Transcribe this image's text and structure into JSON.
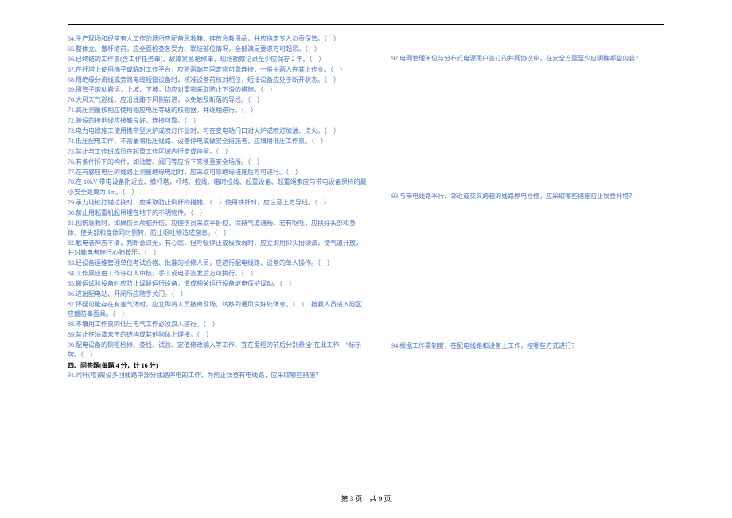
{
  "lines_left": [
    "64.生产现场和经常有人工作的场所应配备急救箱，存放急救用品，并应指定专人负责保管。（　）",
    "65.整体立、撤杆塔前，应全面检查各受力、联结部位情况，全部满足要求方可起吊。（　）",
    "66.已终结的工作票(含工作任务单)、故障紧急抢修单，现场勘察记录至少应保存 2 年。（　）",
    "67.在杆塔上使用梯子或临时工作平台，应将两端与固定物可靠连接，一般由两人在其上作业。（　）",
    "68.用绝缘分流线或旁路电缆短接设备时，核准设备前核对相位，短接设备应处于断开状态。（　）",
    "69.用管子滚动搬运，上坡、下坡，均应对重物采取防止下滑的措施。（　）",
    "70.大风天气巡线，应沿线路下风侧前进，以免触及断落的导线。（　）",
    "71.高压测量核相应使用相应电压等级的核相器，并逐相进行。（　）",
    "72.装设的接地线应接触良好，连接可靠。（　）",
    "73.电力电缆施工使用携带型火炉或喷灯作业时，可在变电站门口对火炉或喷灯加油、点火。（　）",
    "74.低压配电工作，不需要将低压线路、设备停电或做安全措施者，应填用低压工作票。（　）",
    "75.禁止与工作班成员在起重工作区域内行走或停留。（　）",
    "76.有条件拆下的构件，如油管、阀门等应拆下来移至安全场所。（　）",
    "77.在有感应电压的线路上测量绝缘电阻时，应采取可靠绝缘措施后方可进行。（　）",
    "78.在 10kV 带电设备附近立、撤杆塔，杆塔、拉线、临时拉线、起重设备、起重绳索应与带电设备保持的最小安全距离为 1m。（　）",
    "79.承力地桩打锚拉挽时，应采取防止倒杆的措施，（　）使用铁钎时，应注意上方导线。（　）",
    "80.禁止用起重机起吊埋在地下的不明物件。（　）",
    "81.创伤急救时，如果伤员颅脑外伤，应使伤员采取平卧位，保持气道通畅，若有呕吐，应扶好头部和身体，使头部和身体同时侧转，防止呕吐物造成窒息。（　）",
    "82.触电者神志不清，判断意识无，有心跳，但呼吸停止或极微弱时，应立即用仰头抬颌法，使气道开放，并对触电者施行心肺按压。（　）",
    "83.经设备运维管理单位考试合格、批准的检修人员，应进行配电线路、设备的单人操作。（　）",
    "84.工作票应由工作许可人审核，手工或电子签发后方可执行。（　）",
    "85.搬运试验设备时应防止误碰运行设备，造成相关运行设备继电保护误动。（　）",
    "86.进出配电站、开闭所应随手关门。（　）",
    "87.怀疑可能存在有害气体时，应立即将人员撤离现场，转移到通风良好处休息。（　）　抢救人员进入险区应戴防毒面具。（　）",
    "88.不填用工作票的低压电气工作必须双人进行。（　）",
    "89.禁止在油漆未干的结构或其他物体上焊接。（　）",
    "90.配电设备的倒柜检修、查线、试验、定值修改输入等工作，宜在盘柜的前后分别悬挂“在此工作！”标示牌。（　）"
  ],
  "section_title": "四、问答题(每题 4 分，计 16 分)",
  "q91": "91.同杆(塔)架设多回线路中部分线路停电的工作，为防止误登有电线路，应采取哪些措施？",
  "lines_right": [
    "92.电网管理单位与分布式电源用户签订的并网协议中，在安全方面至少应明确哪些内容？",
    "93.与带电线路平行、邻近或交叉跨越的线路停电检修，应采取哪些措施防止误登杆塔？",
    "94.根据工作票制度，在配电线路和设备上工作，按哪些方式进行？"
  ],
  "footer": {
    "page_current": "第 3 页",
    "page_total": "共 9 页"
  }
}
